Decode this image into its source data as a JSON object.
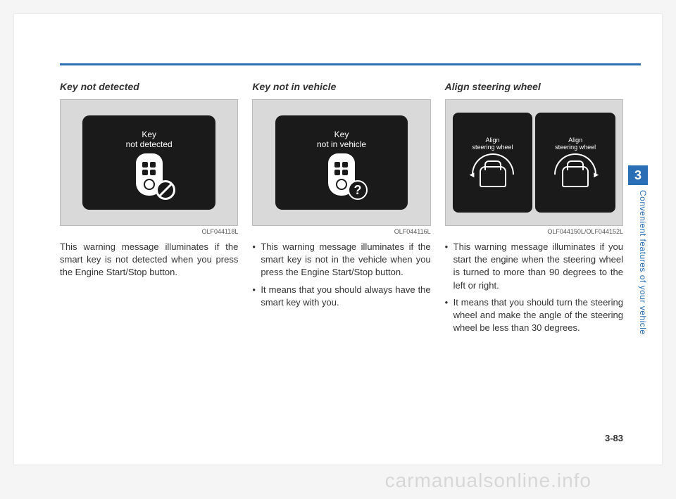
{
  "chapter_number": "3",
  "chapter_title": "Convenient features of your vehicle",
  "page_number": "3-83",
  "watermark": "carmanualsonline.info",
  "columns": [
    {
      "title": "Key not detected",
      "screen_text": "Key\nnot detected",
      "caption": "OLF044118L",
      "paragraph": "This warning message illuminates if the smart key is not detected when you press the Engine Start/Stop button."
    },
    {
      "title": "Key not in vehicle",
      "screen_text": "Key\nnot in vehicle",
      "caption": "OLF044116L",
      "bullets": [
        "This warning message illuminates if the smart key is not in the vehicle when you press the Engine Start/Stop button.",
        "It means that you should always have the smart key with you."
      ]
    },
    {
      "title": "Align steering wheel",
      "screen_text_a": "Align\nsteering wheel",
      "screen_text_b": "Align\nsteering wheel",
      "caption": "OLF044150L/OLF044152L",
      "bullets": [
        "This warning message illuminates if you start the engine when the steering wheel is turned to more than 90 degrees to the left or right.",
        "It means that you should turn the steering wheel and make the angle of the steering wheel be less than 30 degrees."
      ]
    }
  ]
}
